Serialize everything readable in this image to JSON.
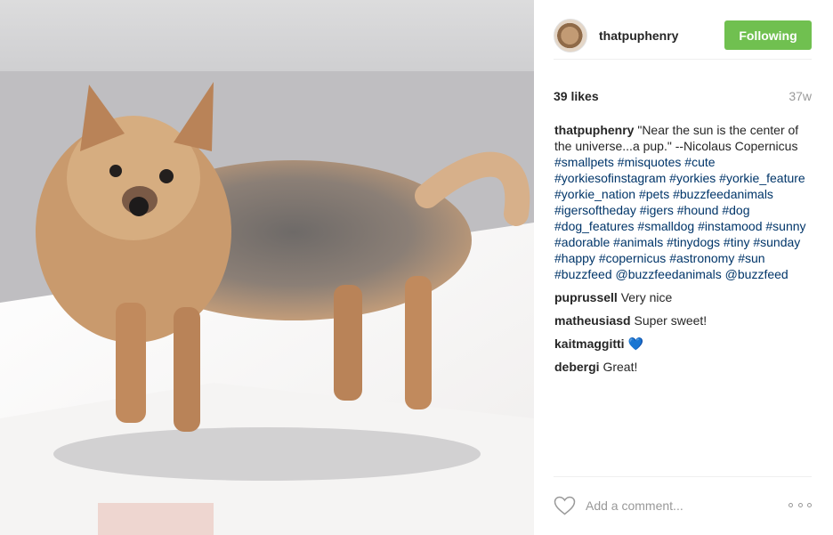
{
  "post": {
    "photo_alt": "Yorkshire terrier standing in sunlight",
    "author": {
      "username": "thatpuphenry",
      "avatar_icon": "avatar-photo"
    },
    "follow_button": {
      "label": "Following",
      "color": "#70c050"
    },
    "likes": "39 likes",
    "time_ago": "37w",
    "caption": {
      "author": "thatpuphenry",
      "text": "\"Near the sun is the center of the universe...a pup.\" --Nicolaus Copernicus",
      "hashtags": "#smallpets #misquotes #cute #yorkiesofinstagram #yorkies #yorkie_feature #yorkie_nation #pets #buzzfeedanimals #igersoftheday #igers #hound #dog #dog_features #smalldog #instamood #sunny #adorable #animals #tinydogs #tiny #sunday #happy #copernicus #astronomy #sun #buzzfeed @buzzfeedanimals @buzzfeed"
    },
    "comments": [
      {
        "author": "puprussell",
        "text": "Very nice"
      },
      {
        "author": "matheusiasd",
        "text": "Super sweet!"
      },
      {
        "author": "kaitmaggitti",
        "text": "💙"
      },
      {
        "author": "debergi",
        "text": "Great!"
      }
    ],
    "add_comment_placeholder": "Add a comment...",
    "icons": {
      "like": "heart-outline-icon",
      "more": "more-options-icon"
    },
    "colors": {
      "hashtag": "#003569",
      "muted": "#999999",
      "text": "#262626"
    }
  }
}
